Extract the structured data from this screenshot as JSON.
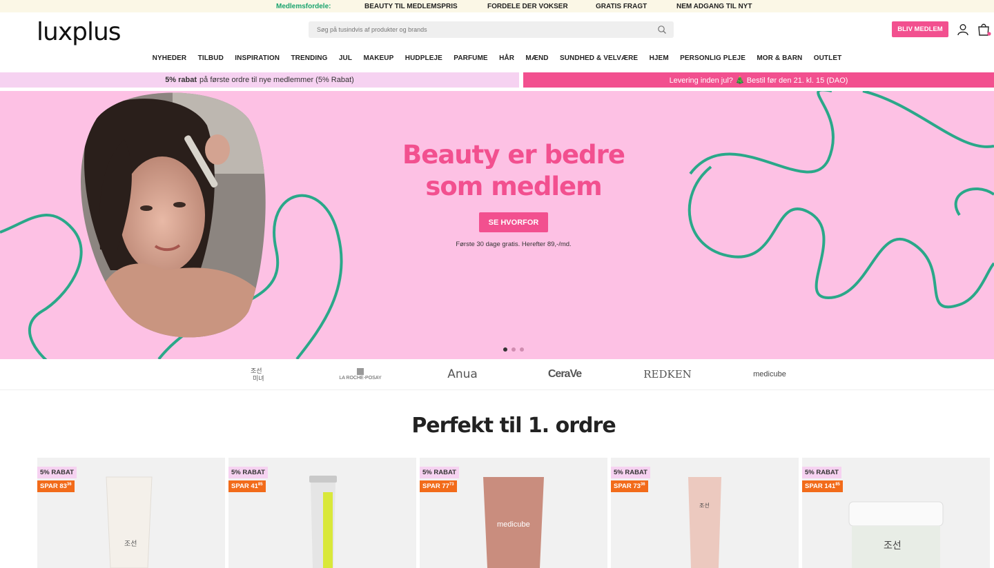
{
  "topbar": {
    "lead": "Medlemsfordele:",
    "items": [
      "BEAUTY TIL MEDLEMSPRIS",
      "FORDELE DER VOKSER",
      "GRATIS FRAGT",
      "NEM ADGANG TIL NYT"
    ]
  },
  "header": {
    "logo": "luxplus",
    "search_placeholder": "Søg på tusindvis af produkter og brands",
    "join_label": "BLIV MEDLEM"
  },
  "nav": [
    "NYHEDER",
    "TILBUD",
    "INSPIRATION",
    "TRENDING",
    "JUL",
    "MAKEUP",
    "HUDPLEJE",
    "PARFUME",
    "HÅR",
    "MÆND",
    "SUNDHED & VELVÆRE",
    "HJEM",
    "PERSONLIG PLEJE",
    "MOR & BARN",
    "OUTLET"
  ],
  "promos": {
    "left_bold": "5% rabat",
    "left_rest": "på første ordre til nye medlemmer (5% Rabat)",
    "right": "Levering inden jul? 🎄 Bestil før den 21. kl. 15 (DAO)"
  },
  "hero": {
    "title_line1": "Beauty er bedre",
    "title_line2": "som medlem",
    "button": "SE HVORFOR",
    "subtext": "Første 30 dage gratis. Herefter 89,-/md.",
    "slide_count": 3,
    "active_slide": 1
  },
  "brands": [
    "Beauty of Joseon",
    "LA ROCHE-POSAY",
    "Anua",
    "CeraVe",
    "REDKEN",
    "medicube"
  ],
  "section": {
    "title": "Perfekt til 1. ordre"
  },
  "products": [
    {
      "discount": "5% RABAT",
      "save": "SPAR 83",
      "save_sup": "36"
    },
    {
      "discount": "5% RABAT",
      "save": "SPAR 41",
      "save_sup": "85"
    },
    {
      "discount": "5% RABAT",
      "save": "SPAR 77",
      "save_sup": "73"
    },
    {
      "discount": "5% RABAT",
      "save": "SPAR 73",
      "save_sup": "36"
    },
    {
      "discount": "5% RABAT",
      "save": "SPAR 141",
      "save_sup": "85"
    }
  ],
  "colors": {
    "brand_pink": "#f2508f",
    "hero_bg": "#fdc1e4",
    "curve_green": "#2aa889",
    "promo_light": "#f6d2f1",
    "save_orange": "#f26b1a",
    "members_green": "#1aa36e"
  }
}
